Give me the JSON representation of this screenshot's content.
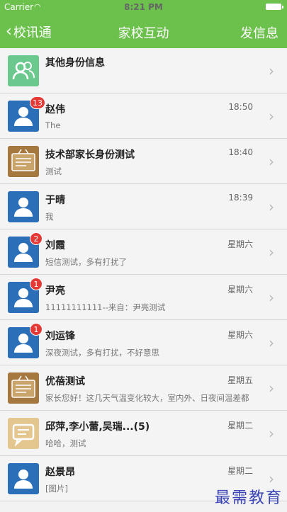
{
  "status_bar": {
    "carrier": "Carrier",
    "time": "8:21 PM"
  },
  "nav": {
    "back_label": "校讯通",
    "title": "家校互动",
    "action_label": "发信息"
  },
  "rows": [
    {
      "name": "其他身份信息",
      "time": "",
      "preview": "",
      "badge": "",
      "avatar": "group"
    },
    {
      "name": "赵伟",
      "time": "18:50",
      "preview": "The",
      "badge": "13",
      "avatar": "person"
    },
    {
      "name": "技术部家长身份测试",
      "time": "18:40",
      "preview": "测试",
      "badge": "",
      "avatar": "board"
    },
    {
      "name": "于晴",
      "time": "18:39",
      "preview": "我",
      "badge": "",
      "avatar": "person"
    },
    {
      "name": "刘霞",
      "time": "星期六",
      "preview": "短信测试，多有打扰了",
      "badge": "2",
      "avatar": "person"
    },
    {
      "name": "尹亮",
      "time": "星期六",
      "preview": "11111111111--来自：尹亮测试",
      "badge": "1",
      "avatar": "person"
    },
    {
      "name": "刘运锋",
      "time": "星期六",
      "preview": "深夜测试，多有打扰，不好意思",
      "badge": "1",
      "avatar": "person"
    },
    {
      "name": "优蓓测试",
      "time": "星期五",
      "preview": "家长您好！这几天气温变化较大，室内外、日夜间温差都",
      "badge": "",
      "avatar": "board"
    },
    {
      "name": "邱萍,李小蕾,吴瑞...(5)",
      "time": "星期二",
      "preview": "哈哈，测试",
      "badge": "",
      "avatar": "chat"
    },
    {
      "name": "赵景昂",
      "time": "星期二",
      "preview": "[图片]",
      "badge": "",
      "avatar": "person"
    }
  ],
  "watermark": "最需教育"
}
